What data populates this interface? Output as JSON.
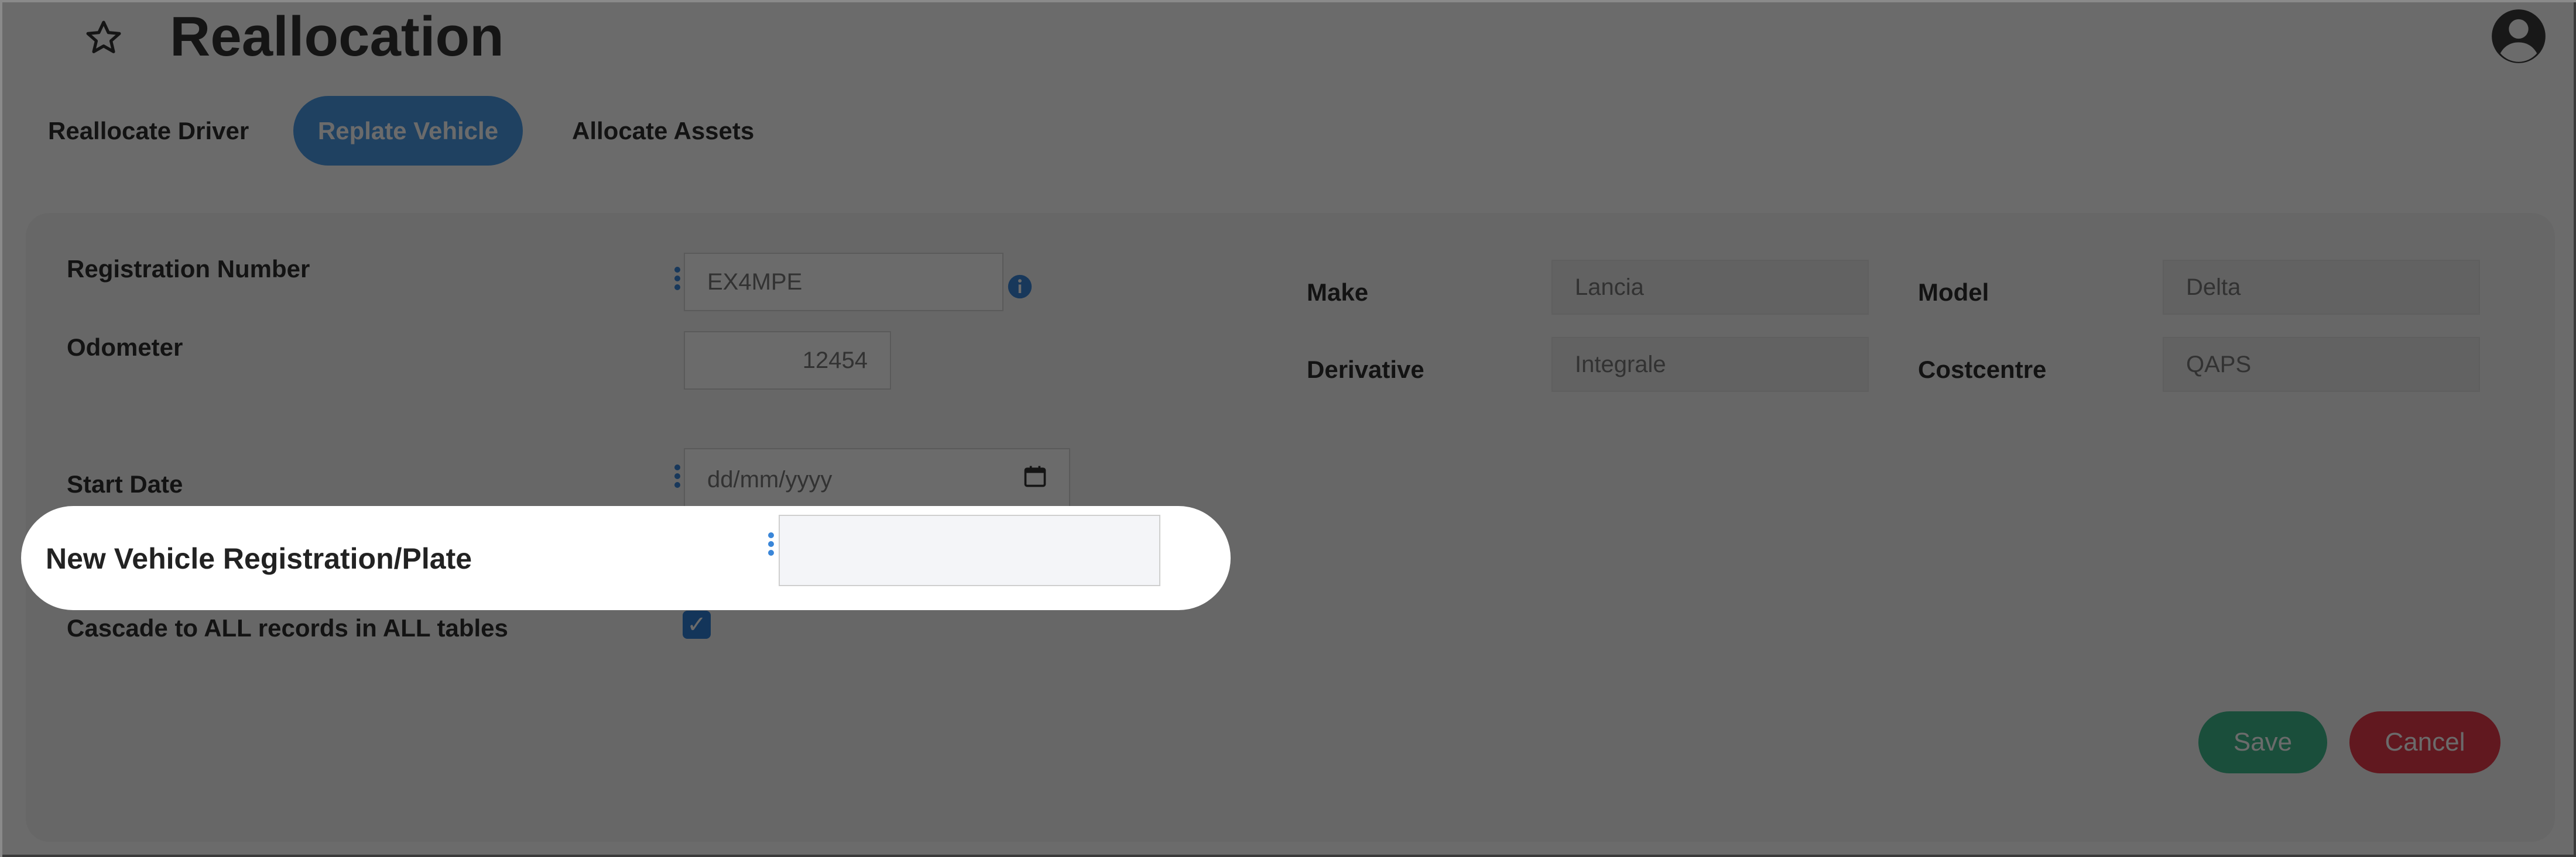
{
  "header": {
    "title": "Reallocation",
    "favorite_icon": "star-icon",
    "account_icon": "avatar-icon"
  },
  "tabs": [
    {
      "label": "Reallocate Driver",
      "active": false
    },
    {
      "label": "Replate Vehicle",
      "active": true
    },
    {
      "label": "Allocate Assets",
      "active": false
    }
  ],
  "form": {
    "registration": {
      "label": "Registration Number",
      "value": "EX4MPE"
    },
    "odometer": {
      "label": "Odometer",
      "value": "12454"
    },
    "start_date": {
      "label": "Start Date",
      "placeholder": "dd/mm/yyyy"
    },
    "new_plate": {
      "label": "New Vehicle Registration/Plate",
      "value": ""
    },
    "cascade": {
      "label": "Cascade to ALL records in ALL tables",
      "checked": true,
      "check_glyph": "✓"
    },
    "make": {
      "label": "Make",
      "value": "Lancia"
    },
    "model": {
      "label": "Model",
      "value": "Delta"
    },
    "derivative": {
      "label": "Derivative",
      "value": "Integrale"
    },
    "costcentre": {
      "label": "Costcentre",
      "value": "QAPS"
    }
  },
  "actions": {
    "save_label": "Save",
    "cancel_label": "Cancel"
  },
  "colors": {
    "accent": "#4a9be8",
    "save": "#3fba8c",
    "cancel": "#e8394b"
  }
}
